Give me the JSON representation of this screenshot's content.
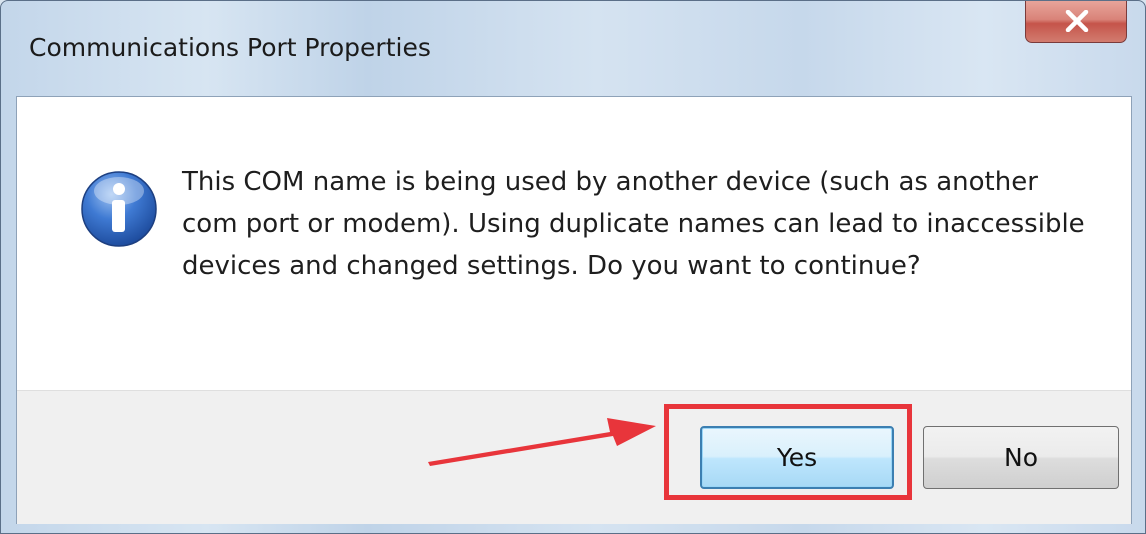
{
  "window": {
    "title": "Communications Port Properties"
  },
  "dialog": {
    "icon": "info-icon",
    "message": "This COM name is being used by another device (such as another com port or modem).  Using duplicate names can lead to inaccessible devices and changed settings.  Do you want to continue?",
    "buttons": {
      "yes_label": "Yes",
      "no_label": "No"
    }
  },
  "annotation": {
    "highlight_color": "#e8353b",
    "arrow_color": "#e8353b",
    "highlighted_button": "Yes"
  },
  "colors": {
    "focused_button_border": "#3c7fb1",
    "close_button": "#c5544a",
    "info_icon": "#2d62b8"
  }
}
